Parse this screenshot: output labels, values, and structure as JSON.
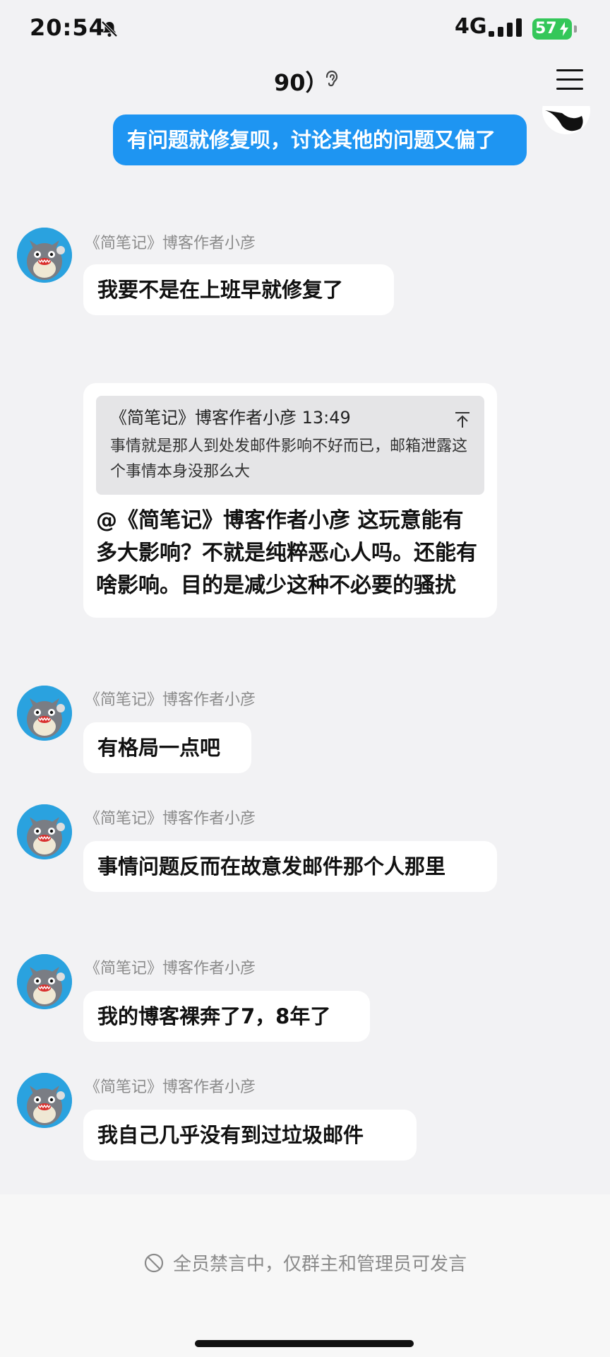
{
  "status_bar": {
    "time": "20:54",
    "network": "4G",
    "battery": "57"
  },
  "header": {
    "title": "90）"
  },
  "self_message": {
    "text": "有问题就修复呗，讨论其他的问题又偏了"
  },
  "messages": [
    {
      "sender": "《简笔记》博客作者小彦",
      "text": "我要不是在上班早就修复了"
    },
    {
      "quote": {
        "header": "《简笔记》博客作者小彦 13:49",
        "text": "事情就是那人到处发邮件影响不好而已，邮箱泄露这个事情本身没那么大"
      },
      "text": "@《简笔记》博客作者小彦 这玩意能有多大影响？不就是纯粹恶心人吗。还能有啥影响。目的是减少这种不必要的骚扰"
    },
    {
      "sender": "《简笔记》博客作者小彦",
      "text": "有格局一点吧"
    },
    {
      "sender": "《简笔记》博客作者小彦",
      "text": "事情问题反而在故意发邮件那个人那里"
    },
    {
      "sender": "《简笔记》博客作者小彦",
      "text": "我的博客裸奔了7，8年了"
    },
    {
      "sender": "《简笔记》博客作者小彦",
      "text": "我自己几乎没有到过垃圾邮件"
    }
  ],
  "footer": {
    "notice": "全员禁言中，仅群主和管理员可发言"
  },
  "colors": {
    "self_bubble": "#1e95f2",
    "battery": "#34c759",
    "avatar_bg": "#2aa2df"
  },
  "icons": [
    "bell-off-icon",
    "signal-icon",
    "battery-icon",
    "ear-icon",
    "menu-icon",
    "pin-top-icon",
    "muted-icon",
    "totoro-avatar"
  ]
}
